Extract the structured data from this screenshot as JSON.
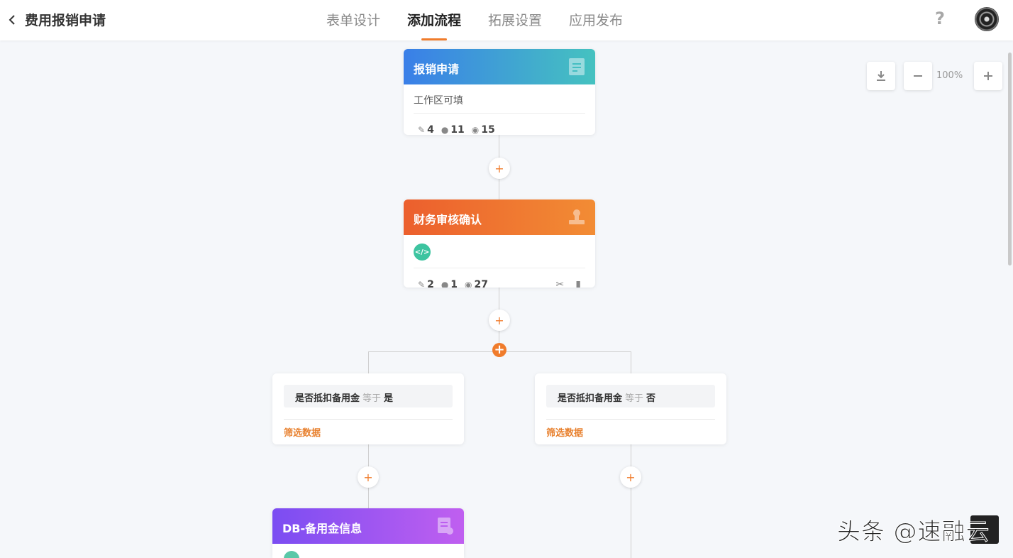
{
  "header": {
    "title": "费用报销申请",
    "tabs": [
      {
        "label": "表单设计",
        "active": false
      },
      {
        "label": "添加流程",
        "active": true
      },
      {
        "label": "拓展设置",
        "active": false
      },
      {
        "label": "应用发布",
        "active": false
      }
    ],
    "help_label": "?"
  },
  "zoom": {
    "level": "100%"
  },
  "nodes": {
    "apply": {
      "title": "报销申请",
      "subtitle": "工作区可填",
      "stats": {
        "edit": "4",
        "comment": "11",
        "view": "15"
      }
    },
    "finance": {
      "title": "财务审核确认",
      "badge": "</>",
      "stats": {
        "edit": "2",
        "comment": "1",
        "view": "27"
      }
    },
    "db": {
      "title": "DB-备用金信息"
    }
  },
  "branches": [
    {
      "field": "是否抵扣备用金",
      "operator": "等于",
      "value": "是",
      "link": "筛选数据"
    },
    {
      "field": "是否抵扣备用金",
      "operator": "等于",
      "value": "否",
      "link": "筛选数据"
    }
  ],
  "add_label": "+",
  "watermark": "头条 @速融云",
  "colors": {
    "accent": "#f07c2c",
    "blue_start": "#3a7fe8",
    "blue_end": "#45c2c0",
    "orange_start": "#ec5f2d",
    "purple_start": "#7b4df2"
  }
}
